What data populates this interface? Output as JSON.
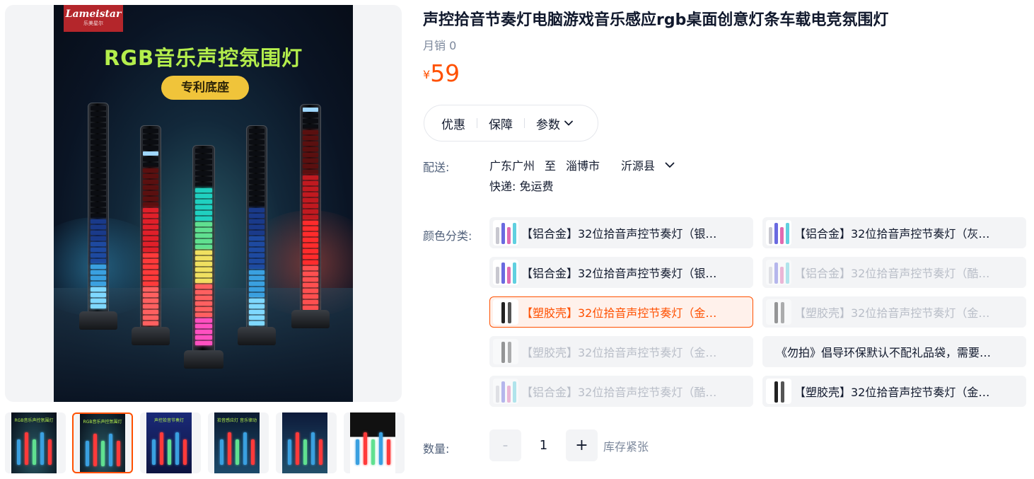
{
  "gallery": {
    "brand_logo": {
      "name": "Lameistar",
      "sub": "乐美星尔"
    },
    "hero_title": "RGB音乐声控氛围灯",
    "hero_badge": "专利底座",
    "thumbnails": [
      {
        "label": "RGB音乐声控氛围灯",
        "active": false
      },
      {
        "label": "RGB音乐声控氛围灯",
        "active": true
      },
      {
        "label": "声控拾音节奏灯",
        "active": false
      },
      {
        "label": "拾音感应灯 音乐律动",
        "active": false
      },
      {
        "label": "",
        "active": false
      },
      {
        "label": "",
        "active": false
      }
    ]
  },
  "product": {
    "title": "声控拾音节奏灯电脑游戏音乐感应rgb桌面创意灯条车载电竞氛围灯",
    "monthly_sales": "月销 0",
    "price_currency": "¥",
    "price": "59"
  },
  "tabs": [
    {
      "label": "优惠"
    },
    {
      "label": "保障"
    },
    {
      "label": "参数",
      "icon": "chevron-down-icon"
    }
  ],
  "shipping": {
    "label": "配送:",
    "from": "广东广州",
    "to_word": "至",
    "to_city": "淄博市",
    "to_county": "沂源县",
    "express": "快递: 免运费"
  },
  "colors": {
    "label": "颜色分类:",
    "options": [
      {
        "text": "【铝合金】32位拾音声控节奏灯（银…",
        "state": "normal"
      },
      {
        "text": "【铝合金】32位拾音声控节奏灯（灰…",
        "state": "normal"
      },
      {
        "text": "【铝合金】32位拾音声控节奏灯（银…",
        "state": "normal"
      },
      {
        "text": "【铝合金】32位拾音声控节奏灯（酷…",
        "state": "disabled"
      },
      {
        "text": "【塑胶壳】32位拾音声控节奏灯（金…",
        "state": "selected"
      },
      {
        "text": "【塑胶壳】32位拾音声控节奏灯（金…",
        "state": "disabled"
      },
      {
        "text": "【塑胶壳】32位拾音声控节奏灯（金…",
        "state": "disabled"
      },
      {
        "text": "《勿拍》倡导环保默认不配礼品袋，需要…",
        "state": "normal"
      },
      {
        "text": "【铝合金】32位拾音声控节奏灯（酷…",
        "state": "disabled"
      },
      {
        "text": "【塑胶壳】32位拾音声控节奏灯（金…",
        "state": "normal"
      }
    ]
  },
  "quantity": {
    "label": "数量:",
    "minus": "-",
    "value": "1",
    "plus": "+",
    "stock_note": "库存紧张"
  },
  "colors_theme": {
    "accent": "#ff5000",
    "text_primary": "#11192d",
    "text_secondary": "#50607a",
    "muted": "#7c889c",
    "chip_bg": "#f3f4f6"
  }
}
